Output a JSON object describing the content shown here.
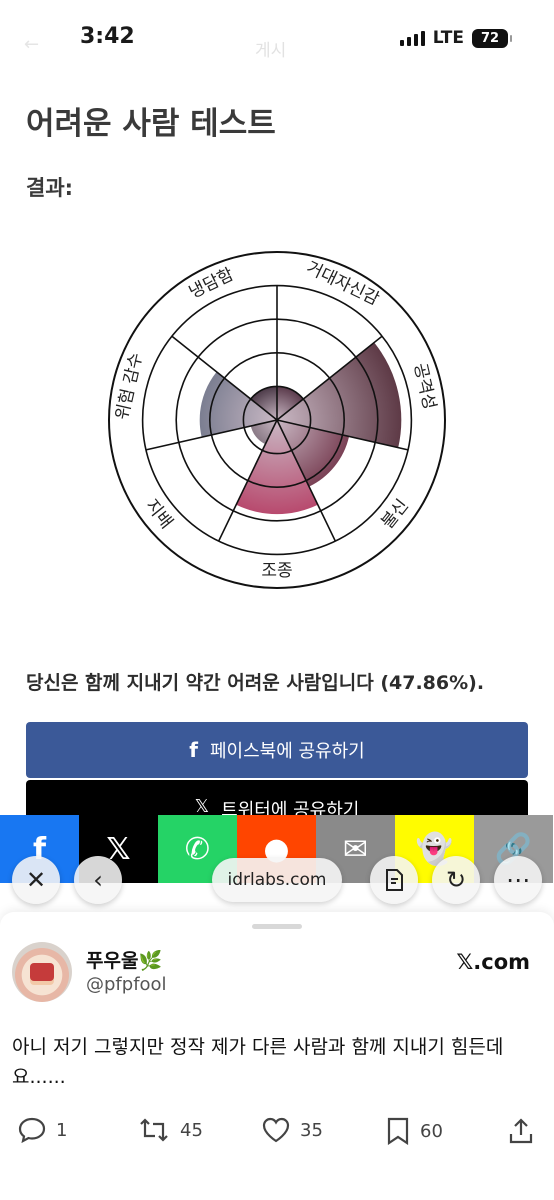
{
  "status_bar": {
    "time": "3:42",
    "faint_title": "게시",
    "network": "LTE",
    "battery": "72"
  },
  "page": {
    "title": "어려운 사람 테스트",
    "result_label": "결과:",
    "summary": "당신은 함께 지내기 약간 어려운 사람입니다 (47.86%)."
  },
  "chart_data": {
    "type": "polar-area",
    "categories": [
      "거대자신감",
      "공격성",
      "불신",
      "조종",
      "지배",
      "위험 감수",
      "냉담함"
    ],
    "values": [
      1,
      3.7,
      2.2,
      2.8,
      0.8,
      2.3,
      1
    ],
    "rmax": 5,
    "rings": 5,
    "colors": [
      "#5a3a4b",
      "#5e3a46",
      "#7a4155",
      "#b84a6e",
      "#8a7a86",
      "#7b7e91",
      "#4c3a48"
    ]
  },
  "buttons": {
    "facebook": {
      "icon": "f",
      "label": "페이스북에 공유하기"
    },
    "twitter": {
      "icon": "𝕏",
      "label": "트위터에 공유하기"
    }
  },
  "share_row": [
    {
      "icon": "facebook-icon",
      "glyph": "f",
      "color": "#1877f2"
    },
    {
      "icon": "x-icon",
      "glyph": "𝕏",
      "color": "#000000"
    },
    {
      "icon": "whatsapp-icon",
      "glyph": "✆",
      "color": "#25d366"
    },
    {
      "icon": "reddit-icon",
      "glyph": "●",
      "color": "#ff4500"
    },
    {
      "icon": "email-icon",
      "glyph": "✉",
      "color": "#8a8a8a"
    },
    {
      "icon": "snapchat-icon",
      "glyph": "👻",
      "color": "#fffc00"
    },
    {
      "icon": "link-icon",
      "glyph": "🔗",
      "color": "#9a9a9a"
    }
  ],
  "browser": {
    "url": "idrlabs.com"
  },
  "tweet": {
    "name": "푸우울",
    "handle": "@pfpfool",
    "source": "𝕏.com",
    "text": "아니 저기 그렇지만 정작 제가 다른 사람과 함께 지내기 힘든데요......",
    "replies": "1",
    "retweets": "45",
    "likes": "35",
    "bookmarks": "60"
  }
}
